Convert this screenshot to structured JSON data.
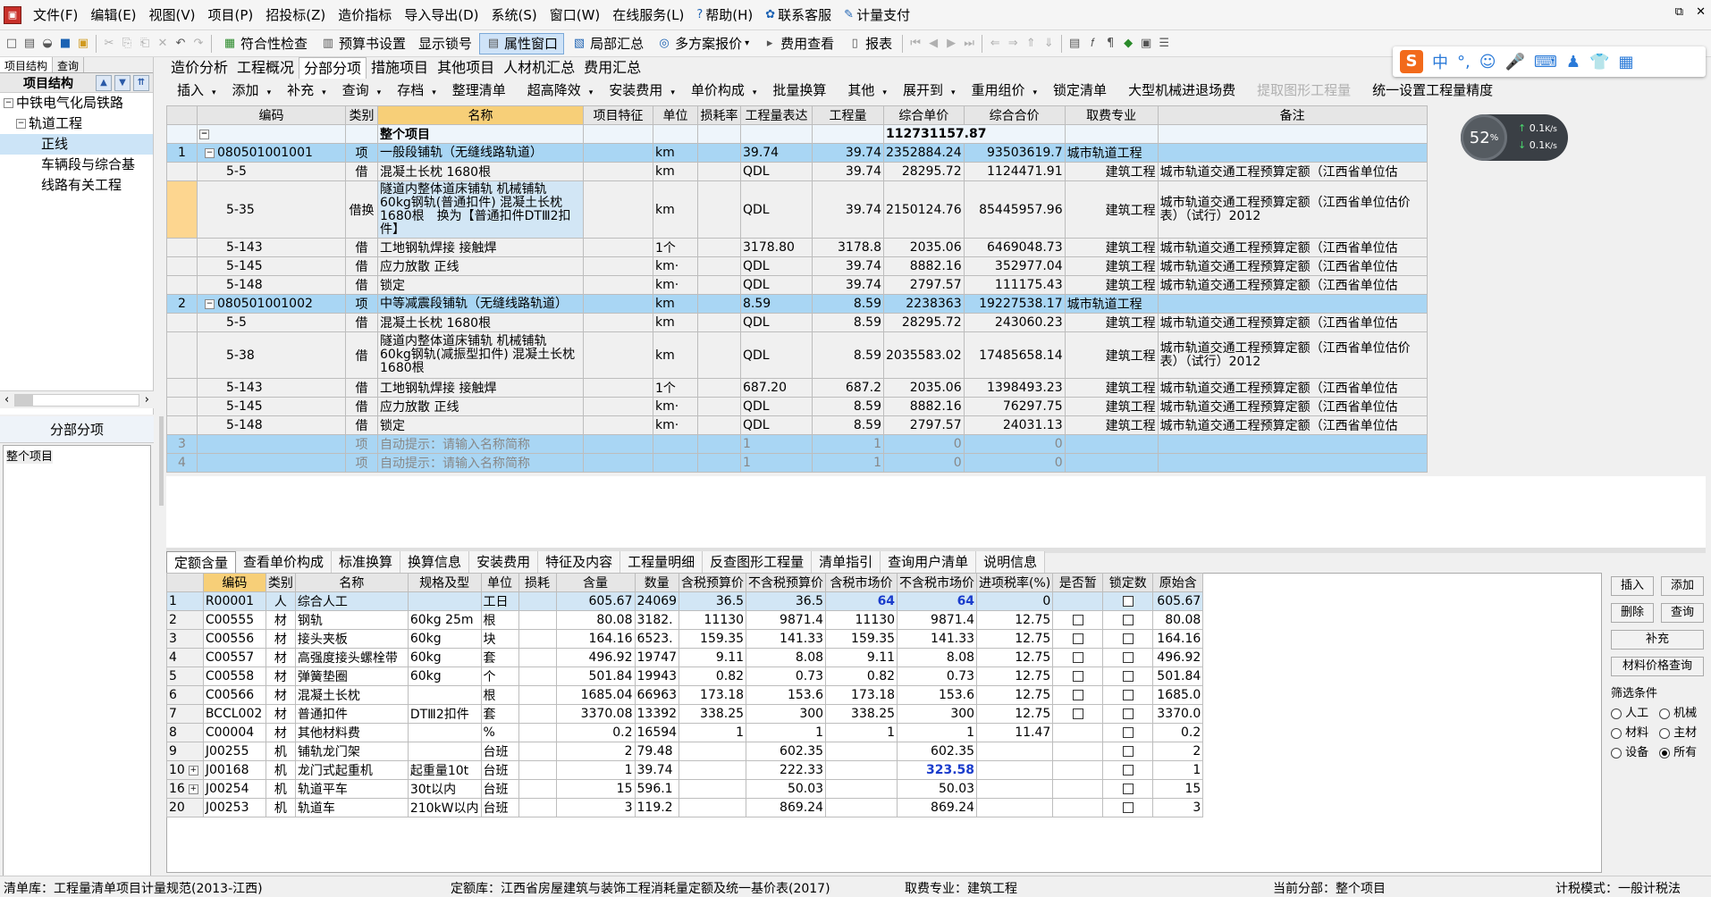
{
  "menu": {
    "items": [
      "文件(F)",
      "编辑(E)",
      "视图(V)",
      "项目(P)",
      "招投标(Z)",
      "造价指标",
      "导入导出(D)",
      "系统(S)",
      "窗口(W)",
      "在线服务(L)"
    ],
    "help": "帮助(H)",
    "service": "联系客服",
    "pay": "计量支付"
  },
  "toolbar": {
    "check": "符合性检查",
    "budget_settings": "预算书设置",
    "show_lock": "显示锁号",
    "property_window": "属性窗口",
    "local_summary": "局部汇总",
    "multi_quote": "多方案报价",
    "fee_view": "费用查看",
    "report": "报表"
  },
  "left_panel": {
    "tabs": [
      "项目结构",
      "查询"
    ],
    "header": "项目结构",
    "tree": [
      "中铁电气化局铁路",
      "轨道工程",
      "正线",
      "车辆段与综合基",
      "线路有关工程"
    ],
    "section_title": "分部分项",
    "section_item": "整个项目"
  },
  "main_tabs": [
    "造价分析",
    "工程概况",
    "分部分项",
    "措施项目",
    "其他项目",
    "人材机汇总",
    "费用汇总"
  ],
  "sub_toolbar": [
    "插入",
    "添加",
    "补充",
    "查询",
    "存档",
    "整理清单",
    "超高降效",
    "安装费用",
    "单价构成",
    "批量换算",
    "其他",
    "展开到",
    "重用组价",
    "锁定清单",
    "大型机械进退场费",
    "提取图形工程量",
    "统一设置工程量精度"
  ],
  "sogou": {
    "letter": "S",
    "lang": "中"
  },
  "net_widget": {
    "percent": "52",
    "unit": "%",
    "up": "0.1",
    "down": "0.1",
    "rate_unit": "K/s"
  },
  "main_table": {
    "headers": [
      "编码",
      "类别",
      "名称",
      "项目特征",
      "单位",
      "损耗率",
      "工程量表达",
      "工程量",
      "综合单价",
      "综合合价",
      "取费专业",
      "备注"
    ],
    "total_row": {
      "label": "整个项目",
      "total": "112731157.87"
    },
    "rows": [
      {
        "no": "1",
        "code": "080501001001",
        "type": "项",
        "name": "一般段铺轨（无缝线路轨道）",
        "unit": "km",
        "expr": "39.74",
        "qty": "39.74",
        "price": "2352884.24",
        "sum": "93503619.7",
        "fee": "城市轨道工程",
        "note": ""
      },
      {
        "no": "",
        "code": "5-5",
        "type": "借",
        "name": "混凝土长枕 1680根",
        "unit": "km",
        "expr": "QDL",
        "qty": "39.74",
        "price": "28295.72",
        "sum": "1124471.91",
        "fee": "建筑工程",
        "note": "城市轨道交通工程预算定额（江西省单位估"
      },
      {
        "no": "",
        "code": "5-35",
        "type": "借换",
        "name": "隧道内整体道床铺轨 机械铺轨 60kg钢轨(普通扣件) 混凝土长枕1680根　换为【普通扣件DTⅢ2扣件】",
        "unit": "km",
        "expr": "QDL",
        "qty": "39.74",
        "price": "2150124.76",
        "sum": "85445957.96",
        "fee": "建筑工程",
        "note": "城市轨道交通工程预算定额（江西省单位估价表）（试行）2012"
      },
      {
        "no": "",
        "code": "5-143",
        "type": "借",
        "name": "工地钢轨焊接 接触焊",
        "unit": "1个",
        "expr": "3178.80",
        "qty": "3178.8",
        "price": "2035.06",
        "sum": "6469048.73",
        "fee": "建筑工程",
        "note": "城市轨道交通工程预算定额（江西省单位估"
      },
      {
        "no": "",
        "code": "5-145",
        "type": "借",
        "name": "应力放散 正线",
        "unit": "km·",
        "expr": "QDL",
        "qty": "39.74",
        "price": "8882.16",
        "sum": "352977.04",
        "fee": "建筑工程",
        "note": "城市轨道交通工程预算定额（江西省单位估"
      },
      {
        "no": "",
        "code": "5-148",
        "type": "借",
        "name": "锁定",
        "unit": "km·",
        "expr": "QDL",
        "qty": "39.74",
        "price": "2797.57",
        "sum": "111175.43",
        "fee": "建筑工程",
        "note": "城市轨道交通工程预算定额（江西省单位估"
      },
      {
        "no": "2",
        "code": "080501001002",
        "type": "项",
        "name": "中等减震段铺轨（无缝线路轨道）",
        "unit": "km",
        "expr": "8.59",
        "qty": "8.59",
        "price": "2238363",
        "sum": "19227538.17",
        "fee": "城市轨道工程",
        "note": ""
      },
      {
        "no": "",
        "code": "5-5",
        "type": "借",
        "name": "混凝土长枕 1680根",
        "unit": "km",
        "expr": "QDL",
        "qty": "8.59",
        "price": "28295.72",
        "sum": "243060.23",
        "fee": "建筑工程",
        "note": "城市轨道交通工程预算定额（江西省单位估"
      },
      {
        "no": "",
        "code": "5-38",
        "type": "借",
        "name": "隧道内整体道床铺轨 机械铺轨 60kg钢轨(减振型扣件) 混凝土长枕 1680根",
        "unit": "km",
        "expr": "QDL",
        "qty": "8.59",
        "price": "2035583.02",
        "sum": "17485658.14",
        "fee": "建筑工程",
        "note": "城市轨道交通工程预算定额（江西省单位估价表）（试行）2012"
      },
      {
        "no": "",
        "code": "5-143",
        "type": "借",
        "name": "工地钢轨焊接 接触焊",
        "unit": "1个",
        "expr": "687.20",
        "qty": "687.2",
        "price": "2035.06",
        "sum": "1398493.23",
        "fee": "建筑工程",
        "note": "城市轨道交通工程预算定额（江西省单位估"
      },
      {
        "no": "",
        "code": "5-145",
        "type": "借",
        "name": "应力放散 正线",
        "unit": "km·",
        "expr": "QDL",
        "qty": "8.59",
        "price": "8882.16",
        "sum": "76297.75",
        "fee": "建筑工程",
        "note": "城市轨道交通工程预算定额（江西省单位估"
      },
      {
        "no": "",
        "code": "5-148",
        "type": "借",
        "name": "锁定",
        "unit": "km·",
        "expr": "QDL",
        "qty": "8.59",
        "price": "2797.57",
        "sum": "24031.13",
        "fee": "建筑工程",
        "note": "城市轨道交通工程预算定额（江西省单位估"
      },
      {
        "no": "3",
        "code": "",
        "type": "项",
        "name": "自动提示：请输入名称简称",
        "unit": "",
        "expr": "1",
        "qty": "1",
        "price": "0",
        "sum": "0",
        "fee": "",
        "note": ""
      },
      {
        "no": "4",
        "code": "",
        "type": "项",
        "name": "自动提示：请输入名称简称",
        "unit": "",
        "expr": "1",
        "qty": "1",
        "price": "0",
        "sum": "0",
        "fee": "",
        "note": ""
      }
    ]
  },
  "bottom_tabs": [
    "定额含量",
    "查看单价构成",
    "标准换算",
    "换算信息",
    "安装费用",
    "特征及内容",
    "工程量明细",
    "反查图形工程量",
    "清单指引",
    "查询用户清单",
    "说明信息"
  ],
  "bottom_table": {
    "headers": [
      "编码",
      "类别",
      "名称",
      "规格及型",
      "单位",
      "损耗",
      "含量",
      "数量",
      "含税预算价",
      "不含税预算价",
      "含税市场价",
      "不含税市场价",
      "进项税率(%)",
      "是否暂",
      "锁定数",
      "原始含"
    ],
    "rows": [
      {
        "no": "1",
        "code": "R00001",
        "type": "人",
        "name": "综合人工",
        "spec": "",
        "unit": "工日",
        "content": "605.67",
        "qty": "24069",
        "tb": "36.5",
        "nb": "36.5",
        "tm": "64",
        "nm": "64",
        "rate": "0",
        "temp": false,
        "orig": "605.67",
        "blue": true
      },
      {
        "no": "2",
        "code": "C00555",
        "type": "材",
        "name": "钢轨",
        "spec": "60kg 25m",
        "unit": "根",
        "content": "80.08",
        "qty": "3182.",
        "tb": "11130",
        "nb": "9871.4",
        "tm": "11130",
        "nm": "9871.4",
        "rate": "12.75",
        "temp": true,
        "orig": "80.08"
      },
      {
        "no": "3",
        "code": "C00556",
        "type": "材",
        "name": "接头夹板",
        "spec": "60kg",
        "unit": "块",
        "content": "164.16",
        "qty": "6523.",
        "tb": "159.35",
        "nb": "141.33",
        "tm": "159.35",
        "nm": "141.33",
        "rate": "12.75",
        "temp": true,
        "orig": "164.16"
      },
      {
        "no": "4",
        "code": "C00557",
        "type": "材",
        "name": "高强度接头螺栓带",
        "spec": "60kg",
        "unit": "套",
        "content": "496.92",
        "qty": "19747",
        "tb": "9.11",
        "nb": "8.08",
        "tm": "9.11",
        "nm": "8.08",
        "rate": "12.75",
        "temp": true,
        "orig": "496.92"
      },
      {
        "no": "5",
        "code": "C00558",
        "type": "材",
        "name": "弹簧垫圈",
        "spec": "60kg",
        "unit": "个",
        "content": "501.84",
        "qty": "19943",
        "tb": "0.82",
        "nb": "0.73",
        "tm": "0.82",
        "nm": "0.73",
        "rate": "12.75",
        "temp": true,
        "orig": "501.84"
      },
      {
        "no": "6",
        "code": "C00566",
        "type": "材",
        "name": "混凝土长枕",
        "spec": "",
        "unit": "根",
        "content": "1685.04",
        "qty": "66963",
        "tb": "173.18",
        "nb": "153.6",
        "tm": "173.18",
        "nm": "153.6",
        "rate": "12.75",
        "temp": true,
        "orig": "1685.0"
      },
      {
        "no": "7",
        "code": "BCCL002",
        "type": "材",
        "name": "普通扣件",
        "spec": "DTⅢ2扣件",
        "unit": "套",
        "content": "3370.08",
        "qty": "13392",
        "tb": "338.25",
        "nb": "300",
        "tm": "338.25",
        "nm": "300",
        "rate": "12.75",
        "temp": true,
        "orig": "3370.0"
      },
      {
        "no": "8",
        "code": "C00004",
        "type": "材",
        "name": "其他材料费",
        "spec": "",
        "unit": "%",
        "content": "0.2",
        "qty": "16594",
        "tb": "1",
        "nb": "1",
        "tm": "1",
        "nm": "1",
        "rate": "11.47",
        "temp": false,
        "orig": "0.2"
      },
      {
        "no": "9",
        "code": "J00255",
        "type": "机",
        "name": "铺轨龙门架",
        "spec": "",
        "unit": "台班",
        "content": "2",
        "qty": "79.48",
        "tb": "",
        "nb": "602.35",
        "tm": "",
        "nm": "602.35",
        "rate": "",
        "temp": false,
        "orig": "2"
      },
      {
        "no": "10",
        "code": "J00168",
        "type": "机",
        "name": "龙门式起重机",
        "spec": "起重量10t",
        "unit": "台班",
        "content": "1",
        "qty": "39.74",
        "tb": "",
        "nb": "222.33",
        "tm": "",
        "nm": "323.58",
        "rate": "",
        "temp": false,
        "orig": "1",
        "exp": true,
        "nmblue": true
      },
      {
        "no": "16",
        "code": "J00254",
        "type": "机",
        "name": "轨道平车",
        "spec": "30t以内",
        "unit": "台班",
        "content": "15",
        "qty": "596.1",
        "tb": "",
        "nb": "50.03",
        "tm": "",
        "nm": "50.03",
        "rate": "",
        "temp": false,
        "orig": "15",
        "exp": true
      },
      {
        "no": "20",
        "code": "J00253",
        "type": "机",
        "name": "轨道车",
        "spec": "210kW以内",
        "unit": "台班",
        "content": "3",
        "qty": "119.2",
        "tb": "",
        "nb": "869.24",
        "tm": "",
        "nm": "869.24",
        "rate": "",
        "temp": false,
        "orig": "3"
      }
    ]
  },
  "right_buttons": {
    "insert": "插入",
    "add": "添加",
    "delete": "删除",
    "query": "查询",
    "supplement": "补充",
    "price_query": "材料价格查询",
    "filter": "筛选条件",
    "labor": "人工",
    "machine": "机械",
    "material": "材料",
    "main_material": "主材",
    "equipment": "设备",
    "all": "所有"
  },
  "status": {
    "list_lib": "清单库：工程量清单项目计量规范(2013-江西)",
    "quota_lib": "定额库：江西省房屋建筑与装饰工程消耗量定额及统一基价表(2017)",
    "fee": "取费专业：建筑工程",
    "section": "当前分部：整个项目",
    "mode": "计税模式：一般计税法"
  }
}
